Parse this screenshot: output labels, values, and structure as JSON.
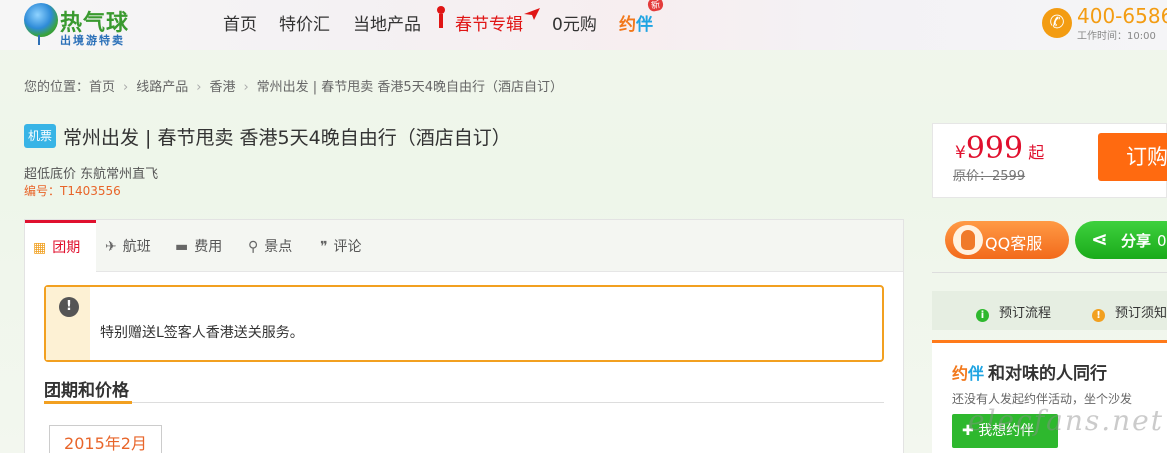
{
  "header": {
    "logo_name": "热气球",
    "logo_sub": "出境游特卖",
    "nav": {
      "home": "首页",
      "deals": "特价汇",
      "local": "当地产品",
      "spring": "春节专辑",
      "zero": "0元购",
      "yueban_1": "约",
      "yueban_2": "伴",
      "new_badge": "新"
    },
    "phone": "400-6586",
    "work_time": "工作时间：10:00"
  },
  "breadcrumb": {
    "prefix": "您的位置：首页",
    "items": [
      "线路产品",
      "香港",
      "常州出发 | 春节甩卖 香港5天4晚自由行（酒店自订）"
    ]
  },
  "product": {
    "badge": "机票",
    "title": "常州出发 | 春节甩卖 香港5天4晚自由行（酒店自订）",
    "subtitle": "超低底价 东航常州直飞",
    "code": "编号：T1403556"
  },
  "price": {
    "currency": "¥",
    "value": "999",
    "suffix": "起",
    "original": "原价：2599",
    "order_label": "订购"
  },
  "side": {
    "qq_label": "QQ客服",
    "share_label": "分享",
    "share_count": "0",
    "booking_flow": "预订流程",
    "booking_notice": "预订须知",
    "yueban_y1": "约",
    "yueban_y2": "伴",
    "yueban_title": "和对味的人同行",
    "yueban_desc": "还没有人发起约伴活动，坐个沙发",
    "yueban_btn": "我想约伴",
    "watermark": "elecfans.net"
  },
  "tabs": [
    "团期",
    "航班",
    "费用",
    "景点",
    "评论"
  ],
  "notice": "特别赠送L签客人香港送关服务。",
  "section": {
    "title": "团期和价格",
    "month": "2015年2月"
  },
  "colors": {
    "brand_red": "#e0102e",
    "order_orange": "#ff6a10",
    "qq_orange": "#f26a1b",
    "share_green": "#1aab1a",
    "notice_border": "#f2a020"
  }
}
